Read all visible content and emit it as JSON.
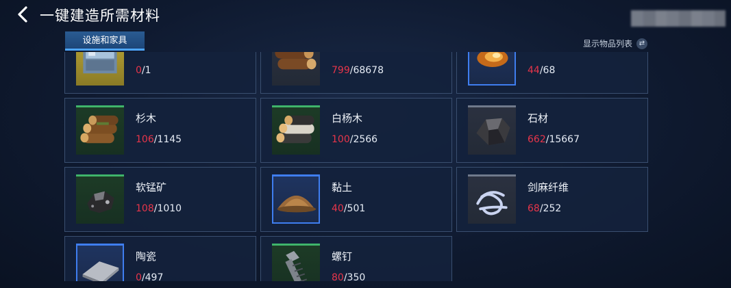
{
  "header": {
    "title": "一键建造所需材料"
  },
  "tab": {
    "label": "设施和家具"
  },
  "show_list": {
    "label": "显示物品列表",
    "icon": "swap-icon"
  },
  "items": [
    {
      "name": "",
      "have": "0",
      "need": "1",
      "rarity": "yellow",
      "icon": "crate-icon"
    },
    {
      "name": "",
      "have": "799",
      "need": "68678",
      "rarity": "gray",
      "icon": "log-icon"
    },
    {
      "name": "",
      "have": "44",
      "need": "68",
      "rarity": "blue",
      "icon": "ember-icon"
    },
    {
      "name": "杉木",
      "have": "106",
      "need": "1145",
      "rarity": "green",
      "icon": "fir-log-icon"
    },
    {
      "name": "白杨木",
      "have": "100",
      "need": "2566",
      "rarity": "green",
      "icon": "poplar-log-icon"
    },
    {
      "name": "石材",
      "have": "662",
      "need": "15667",
      "rarity": "gray",
      "icon": "stone-icon"
    },
    {
      "name": "软锰矿",
      "have": "108",
      "need": "1010",
      "rarity": "green",
      "icon": "ore-icon"
    },
    {
      "name": "黏土",
      "have": "40",
      "need": "501",
      "rarity": "blue",
      "icon": "clay-pile-icon"
    },
    {
      "name": "剑麻纤维",
      "have": "68",
      "need": "252",
      "rarity": "gray",
      "icon": "fiber-icon"
    },
    {
      "name": "陶瓷",
      "have": "0",
      "need": "497",
      "rarity": "blue",
      "icon": "ceramic-tile-icon"
    },
    {
      "name": "螺钉",
      "have": "80",
      "need": "350",
      "rarity": "green",
      "icon": "screw-icon"
    }
  ]
}
